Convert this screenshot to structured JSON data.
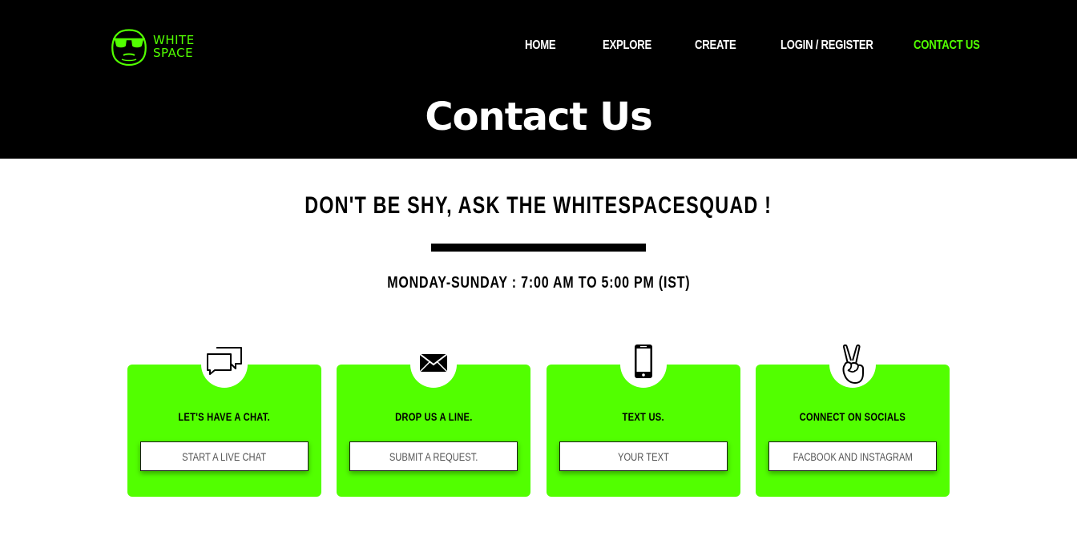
{
  "brand": {
    "line1": "WHITE",
    "line2": "SPACE",
    "accent": "#52ff00"
  },
  "nav": {
    "home": "HOME",
    "explore": "EXPLORE",
    "create": "CREATE",
    "login": "LOGIN / REGISTER",
    "contact": "CONTACT US"
  },
  "hero": {
    "title": "Contact Us"
  },
  "main": {
    "headline": "DON'T BE SHY, ASK THE WHITESPACESQUAD !",
    "hours": "MONDAY-SUNDAY : 7:00 AM TO 5:00 PM (IST)"
  },
  "cards": [
    {
      "icon": "chat-bubbles-icon",
      "title": "LET'S HAVE A CHAT.",
      "button": "START A LIVE CHAT"
    },
    {
      "icon": "envelope-icon",
      "title": "DROP US A LINE.",
      "button": "SUBMIT A REQUEST."
    },
    {
      "icon": "smartphone-icon",
      "title": "TEXT US.",
      "button": "YOUR TEXT"
    },
    {
      "icon": "peace-hand-icon",
      "title": "CONNECT ON SOCIALS",
      "button": "FACBOOK AND INSTAGRAM"
    }
  ]
}
